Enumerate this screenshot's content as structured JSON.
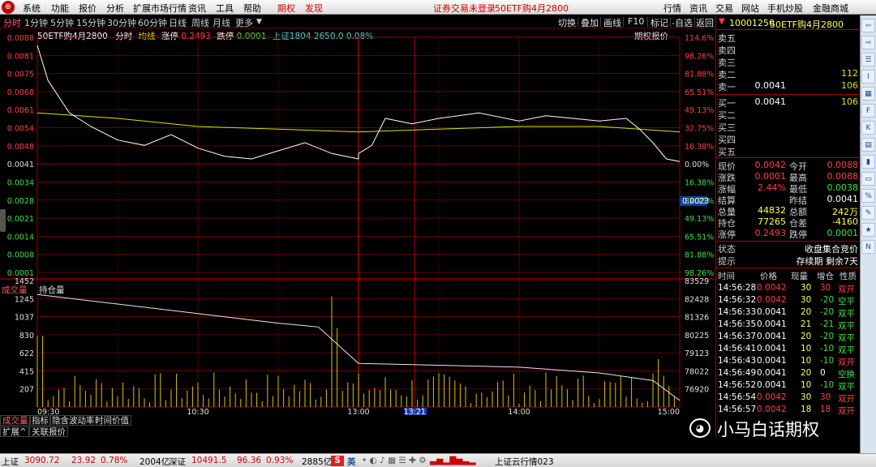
{
  "menubar": {
    "items": [
      "系统",
      "功能",
      "报价",
      "分析",
      "扩展市场行情",
      "资讯",
      "工具",
      "帮助"
    ],
    "red_items": [
      "期权",
      "发现"
    ],
    "notice": "证券交易未登录",
    "contract": "50ETF购4月2800",
    "right_buttons": [
      "行情",
      "资讯",
      "交易",
      "网站",
      "手机炒股",
      "金融商城"
    ]
  },
  "tabs": [
    "分时",
    "1分钟",
    "5分钟",
    "15分钟",
    "30分钟",
    "60分钟",
    "日线",
    "周线",
    "月线",
    "更多"
  ],
  "toolbar": {
    "buttons": [
      "切换",
      "叠加",
      "画线",
      "F10",
      "标记",
      "-自选",
      "返回"
    ],
    "options_quote": "期权报价"
  },
  "chart_info": {
    "name": "50ETF购4月2800",
    "mode": "分时",
    "avg_label": "均线",
    "limit_up_label": "涨停",
    "limit_up": "0.2493",
    "limit_down_label": "跌停",
    "limit_down": "0.0001",
    "index_label": "上证1804 2650.0 0.08%"
  },
  "price_axis": {
    "left": [
      "0.0088",
      "0.0081",
      "0.0075",
      "0.0068",
      "0.0061",
      "0.0054",
      "0.0048",
      "0.0041",
      "0.0034",
      "0.0028",
      "0.0021",
      "0.0014",
      "0.0008",
      "0.0001"
    ],
    "right": [
      "114.6%",
      "98.26%",
      "81.88%",
      "65.51%",
      "49.13%",
      "32.75%",
      "16.38%",
      "0.00%",
      "16.38%",
      "32.75%",
      "49.13%",
      "65.51%",
      "81.88%",
      "98.26%"
    ],
    "cursor_value": "0.0023"
  },
  "volume_axis": {
    "title": "成交量",
    "oi_label": "持仓量",
    "left": [
      "1452",
      "1245",
      "1037",
      "830",
      "622",
      "415",
      "207"
    ],
    "right": [
      "83529",
      "82428",
      "81326",
      "80225",
      "79123",
      "78022",
      "76920"
    ]
  },
  "time_axis": {
    "labels": [
      "09:30",
      "10:30",
      "13:00",
      "14:00",
      "15:00"
    ],
    "cursor_time": "13:21"
  },
  "chart_data": {
    "type": "line",
    "price_series": {
      "name": "",
      "x": [
        "09:30",
        "09:34",
        "09:38",
        "09:42",
        "09:50",
        "10:00",
        "10:10",
        "10:20",
        "10:30",
        "10:40",
        "10:50",
        "11:00",
        "11:10",
        "11:20",
        "11:30",
        "13:00",
        "13:05",
        "13:10",
        "13:20",
        "13:30",
        "13:45",
        "14:00",
        "14:10",
        "14:20",
        "14:30",
        "14:40",
        "14:45",
        "14:50",
        "14:55",
        "15:00"
      ],
      "values": [
        0.0085,
        0.0072,
        0.0066,
        0.006,
        0.0055,
        0.005,
        0.0048,
        0.0052,
        0.0047,
        0.0044,
        0.0043,
        0.0046,
        0.0049,
        0.0045,
        0.0043,
        0.0045,
        0.0048,
        0.0058,
        0.0056,
        0.0058,
        0.006,
        0.0057,
        0.0059,
        0.0058,
        0.0057,
        0.0058,
        0.0054,
        0.0049,
        0.0043,
        0.0042
      ]
    },
    "avg_series": {
      "name": "均线",
      "x": [
        "09:30",
        "10:00",
        "10:30",
        "11:00",
        "11:30",
        "13:00",
        "13:30",
        "14:00",
        "14:30",
        "15:00"
      ],
      "values": [
        0.006,
        0.0058,
        0.0055,
        0.0054,
        0.0053,
        0.0053,
        0.0054,
        0.0055,
        0.0055,
        0.0053
      ]
    },
    "open_interest": {
      "name": "持仓量",
      "x": [
        "09:30",
        "10:00",
        "10:30",
        "11:00",
        "11:15",
        "11:30",
        "13:00",
        "13:30",
        "14:00",
        "14:30",
        "14:50",
        "15:00"
      ],
      "values": [
        82800,
        82300,
        81800,
        81300,
        81100,
        79200,
        79200,
        79100,
        79000,
        78700,
        78300,
        77265
      ]
    },
    "ylim_price": [
      0.0001,
      0.0088
    ],
    "ylim_volume": [
      0,
      1452
    ]
  },
  "quote": {
    "title_code": "10001250",
    "title_name": "50ETF购4月2800",
    "asks": [
      {
        "label": "卖五",
        "price": "",
        "vol": ""
      },
      {
        "label": "卖四",
        "price": "",
        "vol": ""
      },
      {
        "label": "卖三",
        "price": "",
        "vol": ""
      },
      {
        "label": "卖二",
        "price": "",
        "vol": "112"
      },
      {
        "label": "卖一",
        "price": "0.0041",
        "vol": "106"
      }
    ],
    "bids": [
      {
        "label": "买一",
        "price": "0.0041",
        "vol": "106"
      },
      {
        "label": "买二",
        "price": "",
        "vol": ""
      },
      {
        "label": "买三",
        "price": "",
        "vol": ""
      },
      {
        "label": "买四",
        "price": "",
        "vol": ""
      },
      {
        "label": "买五",
        "price": "",
        "vol": ""
      }
    ],
    "stats": [
      {
        "l1": "现价",
        "v1": "0.0042",
        "l2": "今开",
        "v2": "0.0088"
      },
      {
        "l1": "涨跌",
        "v1": "0.0001",
        "l2": "最高",
        "v2": "0.0088"
      },
      {
        "l1": "涨幅",
        "v1": "2.44%",
        "l2": "最低",
        "v2": "0.0038"
      },
      {
        "l1": "结算",
        "v1": "",
        "l2": "昨结",
        "v2": "0.0041"
      },
      {
        "l1": "总量",
        "v1": "44832",
        "l2": "总额",
        "v2": "242万"
      },
      {
        "l1": "持仓",
        "v1": "77265",
        "l2": "仓差",
        "v2": "-4160"
      },
      {
        "l1": "涨停",
        "v1": "0.2493",
        "l2": "跌停",
        "v2": "0.0001"
      }
    ],
    "status_label": "状态",
    "status_value": "收盘集合竞价",
    "hint_label": "提示",
    "hint_value": "存续期 剩余7天",
    "trades_header": [
      "时间",
      "价格",
      "现量",
      "增仓",
      "性质"
    ],
    "trades": [
      {
        "t": "14:56:28",
        "p": "0.0042",
        "q": "30",
        "d": "30",
        "n": "双开"
      },
      {
        "t": "14:56:32",
        "p": "0.0042",
        "q": "30",
        "d": "-20",
        "n": "空平"
      },
      {
        "t": "14:56:33",
        "p": "0.0041",
        "q": "20",
        "d": "-20",
        "n": "双平"
      },
      {
        "t": "14:56:35",
        "p": "0.0041",
        "q": "21",
        "d": "-21",
        "n": "双平"
      },
      {
        "t": "14:56:37",
        "p": "0.0041",
        "q": "20",
        "d": "-20",
        "n": "双平"
      },
      {
        "t": "14:56:41",
        "p": "0.0041",
        "q": "10",
        "d": "-10",
        "n": "双平"
      },
      {
        "t": "14:56:43",
        "p": "0.0041",
        "q": "10",
        "d": "-10",
        "n": "双开"
      },
      {
        "t": "14:56:49",
        "p": "0.0041",
        "q": "20",
        "d": "0",
        "n": "空换"
      },
      {
        "t": "14:56:52",
        "p": "0.0041",
        "q": "10",
        "d": "-10",
        "n": "双平"
      },
      {
        "t": "14:56:54",
        "p": "0.0042",
        "q": "30",
        "d": "30",
        "n": "双开"
      },
      {
        "t": "14:56:57",
        "p": "0.0042",
        "q": "18",
        "d": "18",
        "n": "双开"
      }
    ]
  },
  "bottom_tabs": [
    "成交量",
    "指标",
    "隐含波动率",
    "时间价值"
  ],
  "bottom_tabs2": [
    "扩展^",
    "关联报价"
  ],
  "sidebar_icons": [
    "back-icon",
    "forward-icon",
    "list-icon",
    "chart-icon",
    "grid-icon",
    "f10-icon",
    "k-icon",
    "stats-icon",
    "volume-icon",
    "window-icon",
    "percent-icon",
    "pen-icon",
    "star-icon",
    "n-icon"
  ],
  "statusbar": {
    "sh_label": "上证",
    "sh_value": "3090.72",
    "sh_chg": "23.92",
    "sh_pct": "0.78%",
    "sh_amt": "2004亿",
    "sz_label": "深证",
    "sz_value": "10491.5",
    "sz_chg": "96.36",
    "sz_pct": "0.93%",
    "sz_amt": "2885亿",
    "ime": "英",
    "cloud": "上证云行情023"
  },
  "watermark": "小马白话期权",
  "colors": {
    "up": "#ff4040",
    "down": "#40e040",
    "avg": "#e0e000",
    "grid": "#a00000"
  }
}
